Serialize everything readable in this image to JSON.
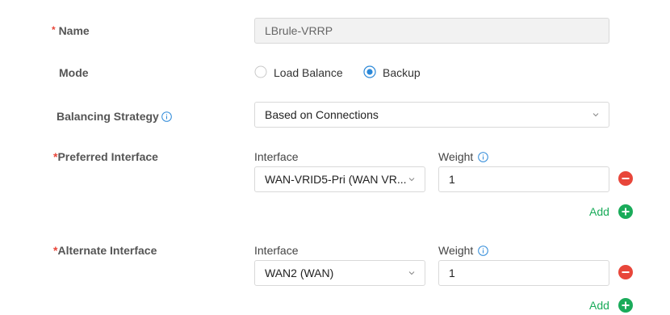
{
  "form": {
    "name": {
      "required_mark": "*",
      "label": "Name",
      "value": "LBrule-VRRP"
    },
    "mode": {
      "label": "Mode",
      "options": [
        {
          "label": "Load Balance",
          "selected": false
        },
        {
          "label": "Backup",
          "selected": true
        }
      ]
    },
    "balancing_strategy": {
      "label": "Balancing Strategy",
      "value": "Based on Connections"
    },
    "preferred": {
      "required_mark": "*",
      "label": "Preferred Interface",
      "interface_header": "Interface",
      "weight_header": "Weight",
      "interface_value": "WAN-VRID5-Pri (WAN VR...",
      "weight_value": "1",
      "add_label": "Add"
    },
    "alternate": {
      "required_mark": "*",
      "label": "Alternate Interface",
      "interface_header": "Interface",
      "weight_header": "Weight",
      "interface_value": "WAN2 (WAN)",
      "weight_value": "1",
      "add_label": "Add"
    }
  },
  "colors": {
    "accent": "#2b88d8",
    "required": "#e8463a",
    "remove": "#e8463a",
    "add": "#1aab5a"
  },
  "icons": [
    "info-icon",
    "chevron-down-icon",
    "remove-circle-icon",
    "add-circle-icon"
  ]
}
